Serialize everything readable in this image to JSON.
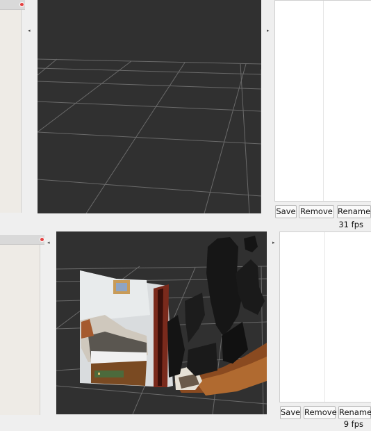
{
  "panels": [
    {
      "buttons": {
        "save": "Save",
        "remove": "Remove",
        "rename": "Rename"
      },
      "fps": "31 fps"
    },
    {
      "buttons": {
        "save": "Save",
        "remove": "Remove",
        "rename": "Rename"
      },
      "fps": "9 fps"
    }
  ],
  "arrows": {
    "left": "◂",
    "right": "▸"
  },
  "colors": {
    "viewport_bg": "#303030",
    "grid_line": "#777777",
    "close_dot": "#e34141",
    "sidebar_bg": "#eeebe6"
  },
  "icons": {
    "close": "close-dot-icon",
    "collapse_left": "collapse-left-icon",
    "collapse_right": "collapse-right-icon"
  }
}
